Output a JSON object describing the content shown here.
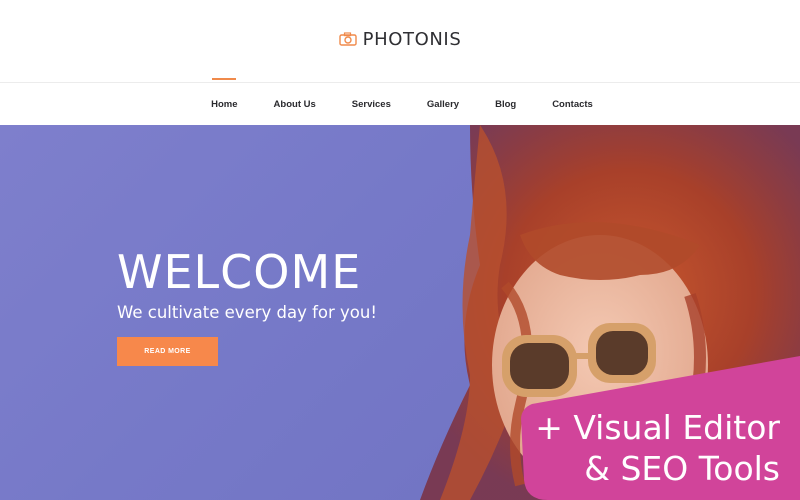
{
  "brand": {
    "name": "PHOTONIS",
    "icon": "camera-icon",
    "accent_color": "#f08a4b"
  },
  "nav": {
    "items": [
      {
        "label": "Home",
        "active": true
      },
      {
        "label": "About Us",
        "active": false
      },
      {
        "label": "Services",
        "active": false
      },
      {
        "label": "Gallery",
        "active": false
      },
      {
        "label": "Blog",
        "active": false
      },
      {
        "label": "Contacts",
        "active": false
      }
    ]
  },
  "hero": {
    "title": "WELCOME",
    "subtitle": "We cultivate every day for you!",
    "button_label": "READ MORE",
    "background_color": "#7679c8",
    "button_color": "#f7884b"
  },
  "promo": {
    "line1": "+ Visual Editor",
    "line2": "& SEO Tools",
    "badge_color": "#d1449a"
  }
}
